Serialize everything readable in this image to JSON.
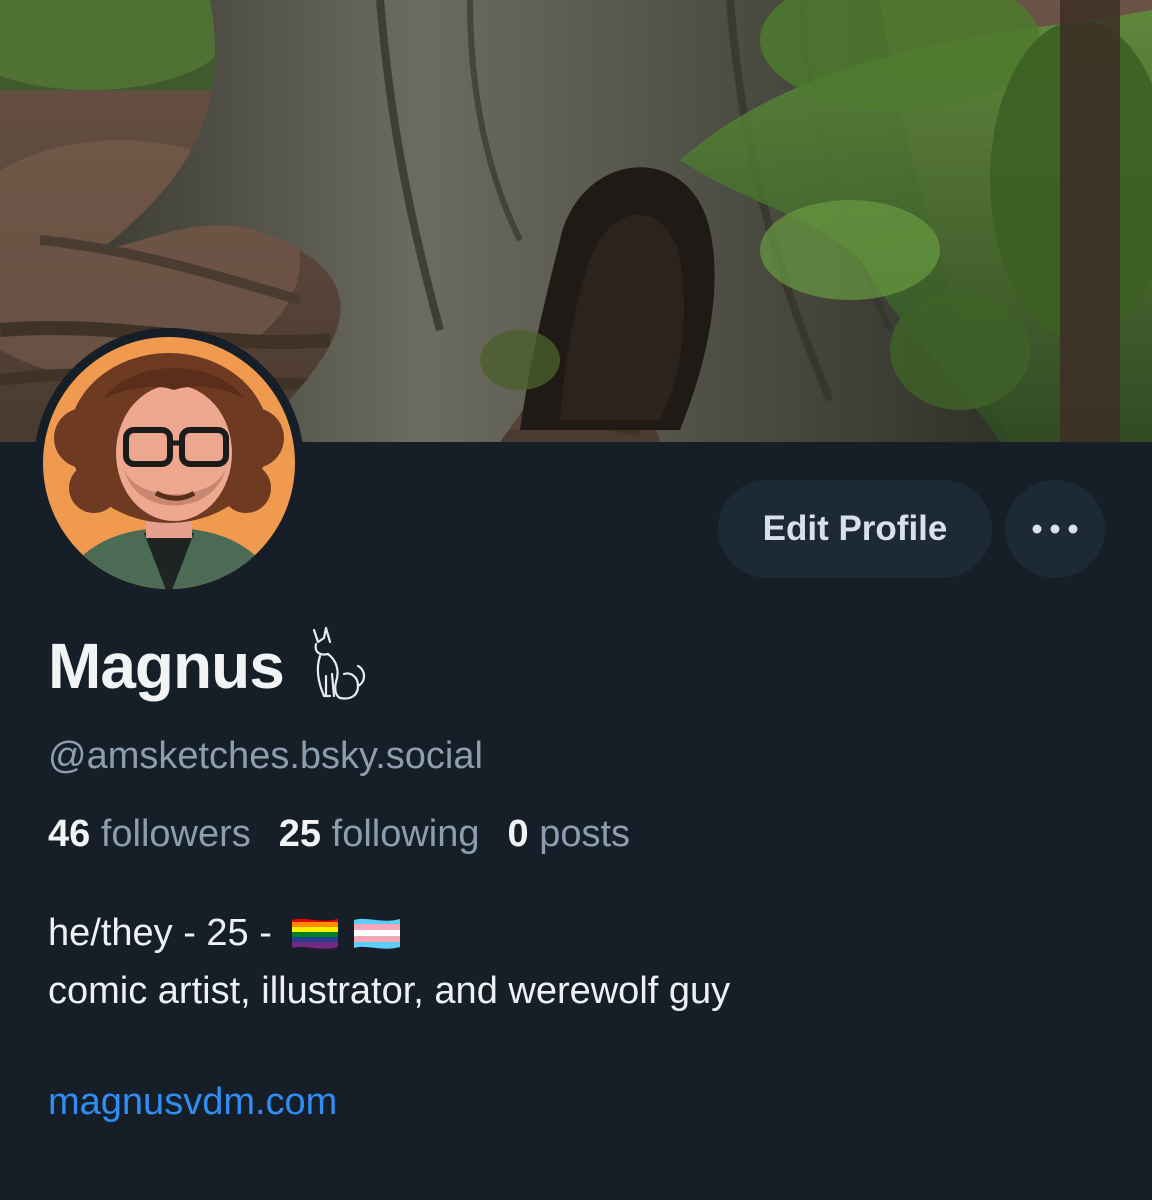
{
  "profile": {
    "display_name": "Magnus",
    "name_icon": "cat-icon",
    "handle": "@amsketches.bsky.social",
    "stats": {
      "followers_count": "46",
      "followers_label": "followers",
      "following_count": "25",
      "following_label": "following",
      "posts_count": "0",
      "posts_label": "posts"
    },
    "bio": {
      "line1_text": "he/they - 25 -",
      "flags": [
        "rainbow-pride-flag-icon",
        "transgender-flag-icon"
      ],
      "line2_text": "comic artist, illustrator, and werewolf guy"
    },
    "website": "magnusvdm.com"
  },
  "actions": {
    "edit_profile_label": "Edit Profile",
    "more_icon": "ellipsis-icon"
  },
  "banner": {
    "icon": "forest-banner-image"
  },
  "colors": {
    "background": "#161e27",
    "button_bg": "#1e2936",
    "muted_text": "#8c9db0",
    "link": "#2f8df5",
    "avatar_bg": "#ef9a4f"
  }
}
